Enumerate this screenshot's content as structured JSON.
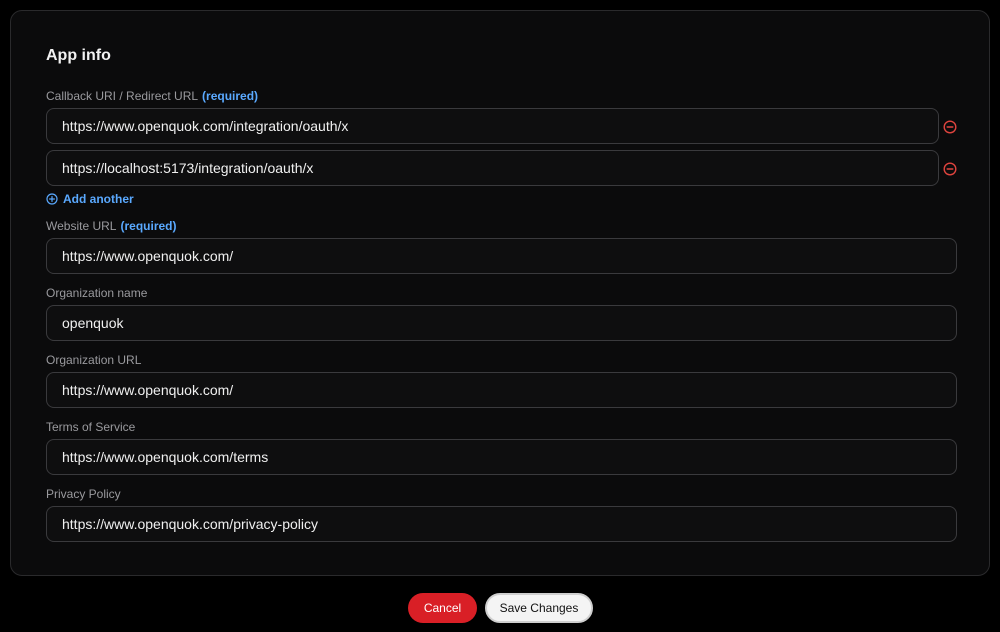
{
  "app_info": {
    "title": "App info",
    "callback": {
      "label": "Callback URI / Redirect URL",
      "required": "(required)",
      "urls": [
        "https://www.openquok.com/integration/oauth/x",
        "https://localhost:5173/integration/oauth/x"
      ],
      "add_another": "Add another"
    },
    "website": {
      "label": "Website URL",
      "required": "(required)",
      "value": "https://www.openquok.com/"
    },
    "org_name": {
      "label": "Organization name",
      "value": "openquok"
    },
    "org_url": {
      "label": "Organization URL",
      "value": "https://www.openquok.com/"
    },
    "terms": {
      "label": "Terms of Service",
      "value": "https://www.openquok.com/terms"
    },
    "privacy": {
      "label": "Privacy Policy",
      "value": "https://www.openquok.com/privacy-policy"
    }
  },
  "actions": {
    "cancel": "Cancel",
    "save": "Save Changes"
  },
  "colors": {
    "accent": "#5aa9ff",
    "danger": "#d91f26",
    "remove_icon": "#e0443e"
  }
}
